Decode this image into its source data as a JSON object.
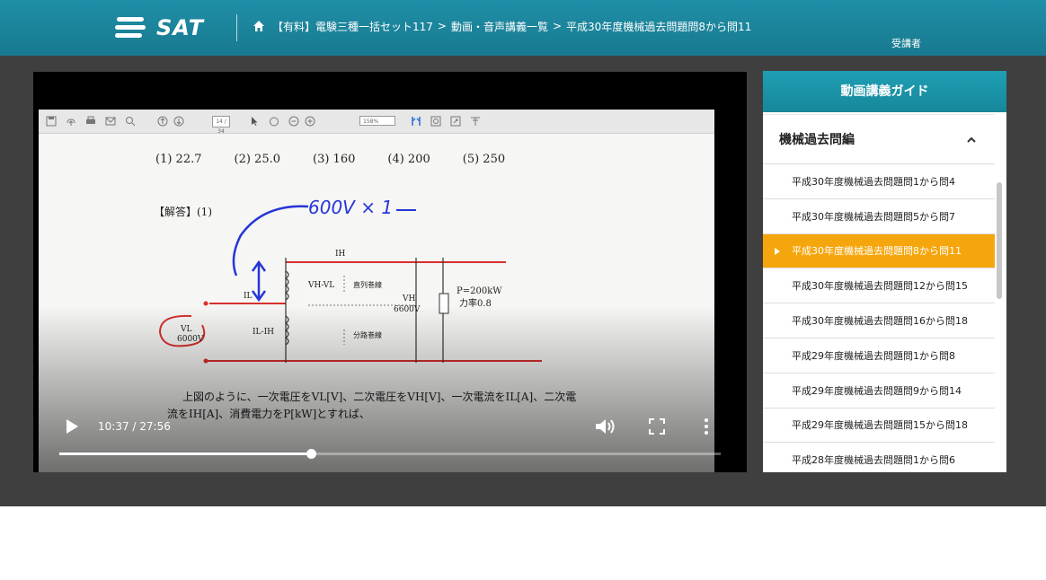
{
  "header": {
    "logo_text": "SAT",
    "breadcrumb": [
      "【有料】電験三種一括セット117",
      "動画・音声講義一覧",
      "平成30年度機械過去問題問8から問11"
    ],
    "breadcrumb_separator": ">",
    "user_label": "受講者"
  },
  "video": {
    "current_time": "10:37",
    "duration": "27:56",
    "time_display": "10:37 / 27:56",
    "progress_fraction": 0.38,
    "frame": {
      "answer_choices": [
        "(1) 22.7",
        "(2) 25.0",
        "(3) 160",
        "(4) 200",
        "(5) 250"
      ],
      "answer_heading": "【解答】(1)",
      "body_line1": "上図のように、一次電圧をVL[V]、二次電圧をVH[V]、一次電流をIL[A]、二次電",
      "body_line2": "流をIH[A]、消費電力をP[kW]とすれば、",
      "page_indicator": "14 / 34",
      "zoom_indicator": "158%"
    }
  },
  "guide": {
    "title": "動画講義ガイド",
    "section": "機械過去問編",
    "lectures": [
      {
        "label": "平成30年度機械過去問題問1から問4",
        "active": false
      },
      {
        "label": "平成30年度機械過去問題問5から問7",
        "active": false
      },
      {
        "label": "平成30年度機械過去問題問8から問11",
        "active": true
      },
      {
        "label": "平成30年度機械過去問題問12から問15",
        "active": false
      },
      {
        "label": "平成30年度機械過去問題問16から問18",
        "active": false
      },
      {
        "label": "平成29年度機械過去問題問1から問8",
        "active": false
      },
      {
        "label": "平成29年度機械過去問題問9から問14",
        "active": false
      },
      {
        "label": "平成29年度機械過去問題問15から問18",
        "active": false
      },
      {
        "label": "平成28年度機械過去問題問1から問6",
        "active": false
      }
    ]
  },
  "colors": {
    "header": "#1b849a",
    "active_item": "#f5a60c",
    "dark_bg": "#3f3f3f"
  }
}
